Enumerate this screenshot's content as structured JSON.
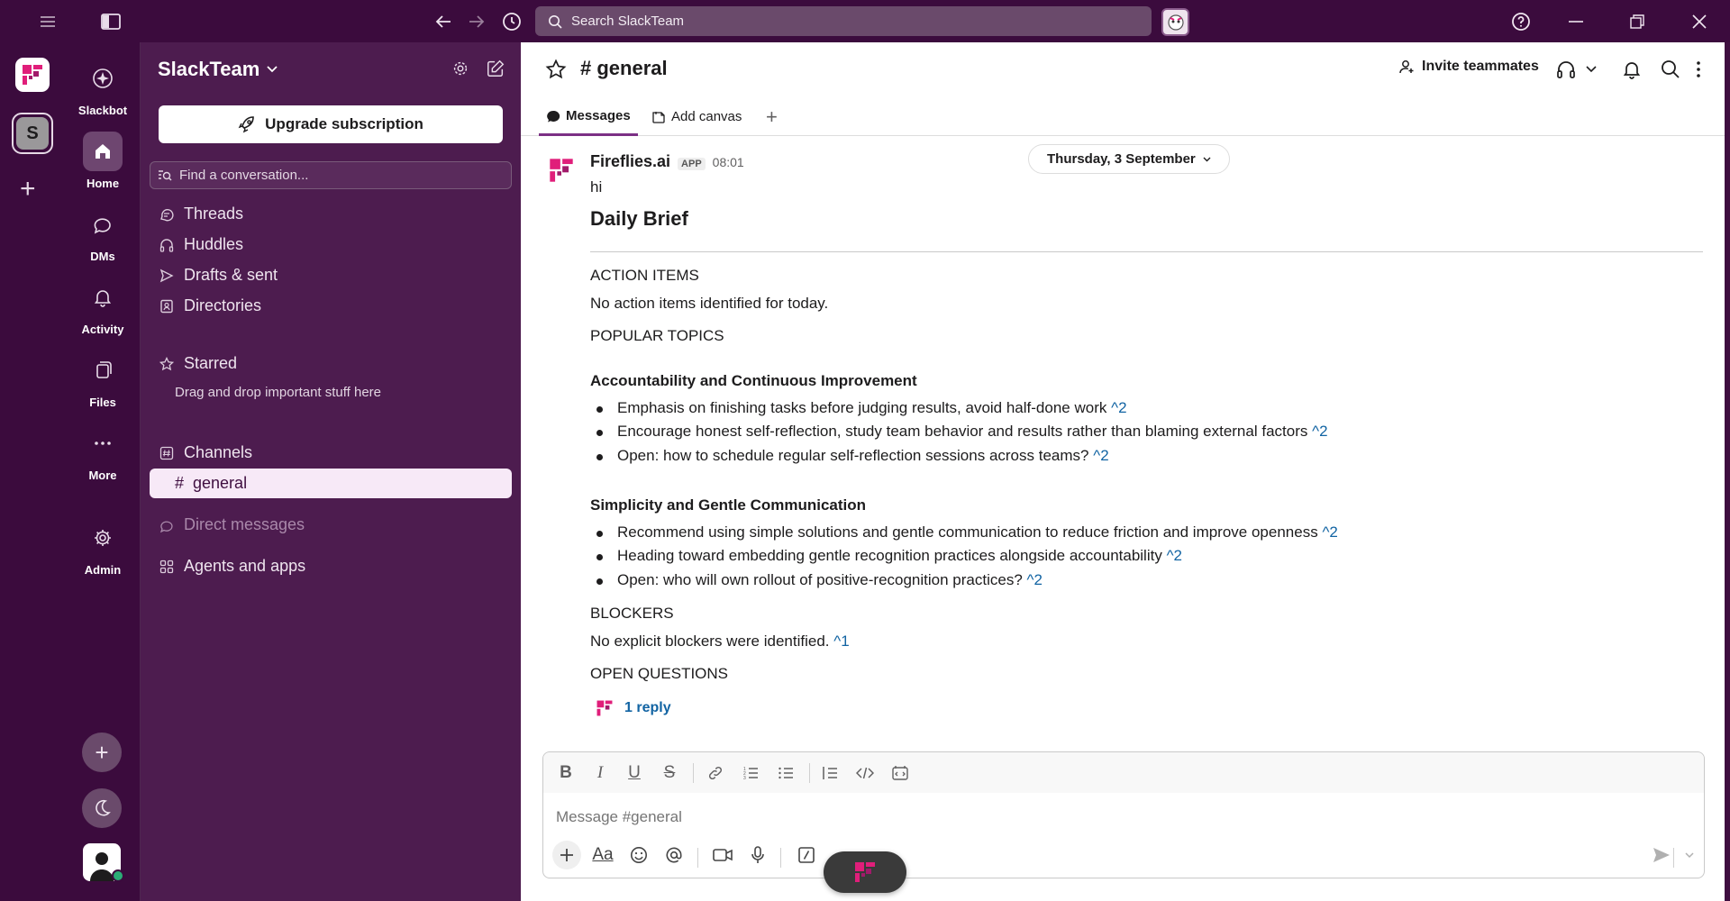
{
  "titlebar": {
    "search_placeholder": "Search SlackTeam",
    "icons": [
      "menu-icon",
      "sidebar-toggle-icon",
      "back-arrow-icon",
      "forward-arrow-icon",
      "history-icon",
      "search-icon",
      "help-icon",
      "minimize-icon",
      "restore-icon",
      "close-icon"
    ]
  },
  "rail": {
    "workspace_letter": "S"
  },
  "nav": {
    "items": [
      {
        "label": "Slackbot",
        "icon": "slackbot-icon"
      },
      {
        "label": "Home",
        "icon": "home-icon"
      },
      {
        "label": "DMs",
        "icon": "dms-icon"
      },
      {
        "label": "Activity",
        "icon": "bell-icon"
      },
      {
        "label": "Files",
        "icon": "files-icon"
      },
      {
        "label": "More",
        "icon": "more-icon"
      },
      {
        "label": "Admin",
        "icon": "gear-icon"
      }
    ]
  },
  "sidebar": {
    "team_name": "SlackTeam",
    "upgrade_label": "Upgrade subscription",
    "find_placeholder": "Find a conversation...",
    "items": [
      {
        "label": "Threads",
        "icon": "threads-icon"
      },
      {
        "label": "Huddles",
        "icon": "headphones-icon"
      },
      {
        "label": "Drafts & sent",
        "icon": "send-icon"
      },
      {
        "label": "Directories",
        "icon": "directory-icon"
      }
    ],
    "starred_label": "Starred",
    "starred_hint": "Drag and drop important stuff here",
    "channels_label": "Channels",
    "channel_active": "general",
    "dm_label": "Direct messages",
    "agents_label": "Agents and apps"
  },
  "channel": {
    "title": "# general",
    "invite_label": "Invite teammates",
    "tabs": [
      {
        "label": "Messages",
        "active": true
      },
      {
        "label": "Add canvas",
        "active": false
      }
    ]
  },
  "message": {
    "date_pill": "Thursday, 3 September",
    "sender": "Fireflies.ai",
    "badge": "APP",
    "time": "08:01",
    "greeting": "hi",
    "brief_title": "Daily Brief",
    "action_items_heading": "ACTION ITEMS",
    "action_items_text": "No action items identified for today.",
    "popular_topics_heading": "POPULAR TOPICS",
    "topic1_title": "Accountability and Continuous Improvement",
    "topic1_bullets": [
      {
        "text": "Emphasis on finishing tasks before judging results, avoid half-done work",
        "ref": "^2"
      },
      {
        "text": "Encourage honest self-reflection, study team behavior and results rather than blaming external factors",
        "ref": "^2"
      },
      {
        "text": "Open: how to schedule regular self-reflection sessions across teams?",
        "ref": "^2"
      }
    ],
    "topic2_title": "Simplicity and Gentle Communication",
    "topic2_bullets": [
      {
        "text": "Recommend using simple solutions and gentle communication to reduce friction and improve openness",
        "ref": "^2"
      },
      {
        "text": "Heading toward embedding gentle recognition practices alongside accountability",
        "ref": "^2"
      },
      {
        "text": "Open: who will own rollout of positive-recognition practices?",
        "ref": "^2"
      }
    ],
    "blockers_heading": "BLOCKERS",
    "blockers_text": "No explicit blockers were identified.",
    "blockers_ref": "^1",
    "open_questions_heading": "OPEN QUESTIONS",
    "reply_label": "1 reply"
  },
  "composer": {
    "placeholder": "Message #general"
  },
  "colors": {
    "sidebar_bg": "#4d1c4f",
    "rail_bg": "#3b0b3d",
    "active_channel_bg": "#f7e9f7",
    "link_blue": "#1264a3",
    "accent_magenta": "#e01e7a"
  }
}
